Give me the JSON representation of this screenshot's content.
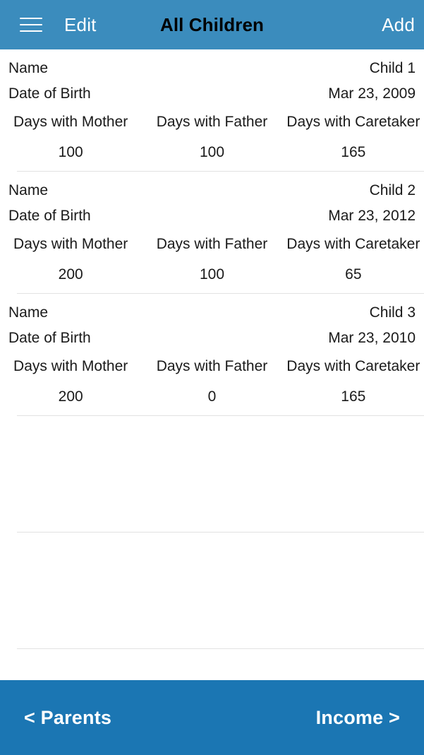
{
  "header": {
    "menu_icon": "hamburger-menu-icon",
    "edit_label": "Edit",
    "title": "All Children",
    "add_label": "Add",
    "background_color": "#3b8cbd",
    "title_color": "#000000",
    "action_color": "#ffffff"
  },
  "list": {
    "key_labels": {
      "name": "Name",
      "dob": "Date of Birth"
    },
    "column_headers": [
      "Days with Mother",
      "Days with Father",
      "Days with Caretaker"
    ],
    "children": [
      {
        "name_label": "Name",
        "name_value": "Child 1",
        "dob_label": "Date of Birth",
        "dob_value": "Mar 23, 2009",
        "days_mother_label": "Days with Mother",
        "days_mother_value": "100",
        "days_father_label": "Days with Father",
        "days_father_value": "100",
        "days_caretaker_label": "Days with Caretaker",
        "days_caretaker_value": "165"
      },
      {
        "name_label": "Name",
        "name_value": "Child 2",
        "dob_label": "Date of Birth",
        "dob_value": "Mar 23, 2012",
        "days_mother_label": "Days with Mother",
        "days_mother_value": "200",
        "days_father_label": "Days with Father",
        "days_father_value": "100",
        "days_caretaker_label": "Days with Caretaker",
        "days_caretaker_value": "65"
      },
      {
        "name_label": "Name",
        "name_value": "Child 3",
        "dob_label": "Date of Birth",
        "dob_value": "Mar 23, 2010",
        "days_mother_label": "Days with Mother",
        "days_mother_value": "200",
        "days_father_label": "Days with Father",
        "days_father_value": "0",
        "days_caretaker_label": "Days with Caretaker",
        "days_caretaker_value": "165"
      }
    ],
    "empty_row_count": 2,
    "separator_color": "#e2e2e2"
  },
  "footer": {
    "prev_label": "< Parents",
    "next_label": "Income >",
    "background_color": "#1b76b3",
    "text_color": "#ffffff"
  }
}
